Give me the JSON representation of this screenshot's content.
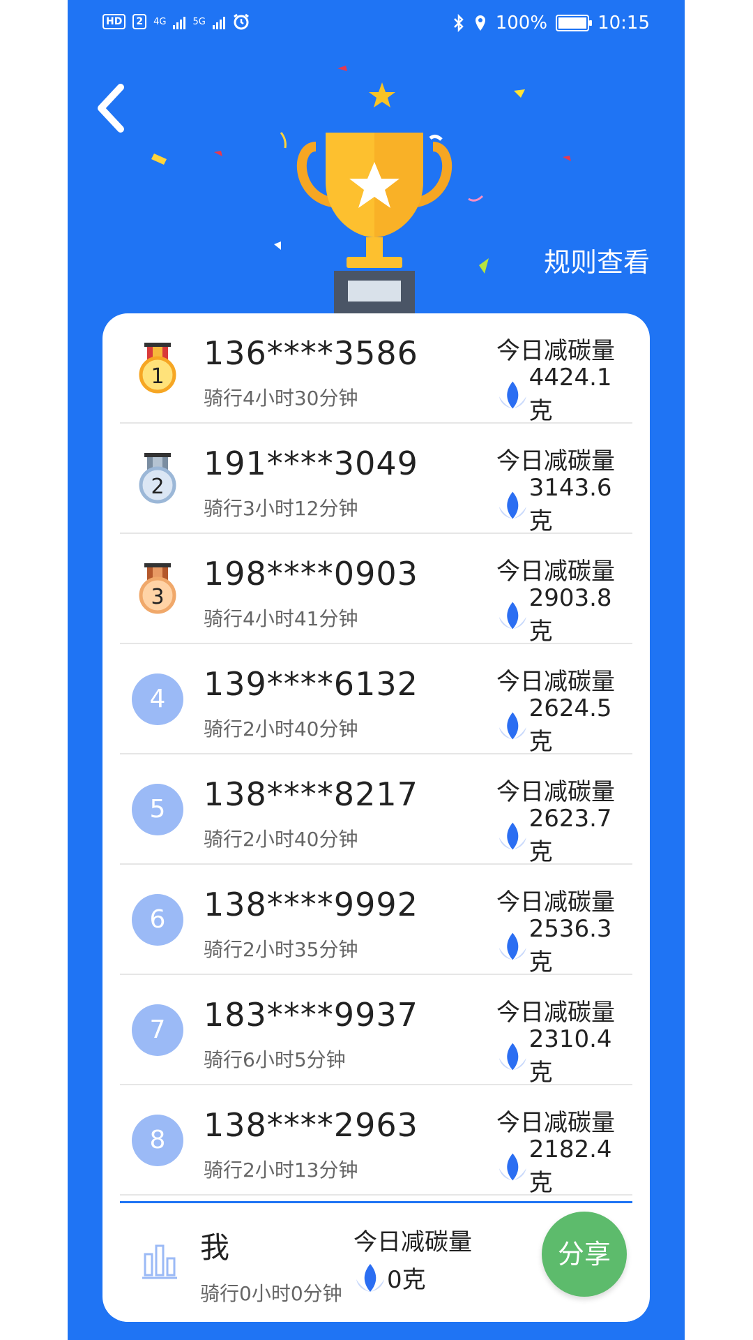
{
  "status_bar": {
    "left_badges": [
      "HD",
      "2",
      "4G",
      "5G"
    ],
    "battery": "100%",
    "time": "10:15"
  },
  "header": {
    "rules_label": "规则查看"
  },
  "colors": {
    "background": "#1f74f4",
    "card": "#ffffff",
    "rank_circle": "#9bbaf6",
    "share": "#5dbb6c",
    "leaf": "#2b6ef2"
  },
  "leaderboard": {
    "carbon_label": "今日减碳量",
    "rows": [
      {
        "rank": "1",
        "phone": "136****3586",
        "ride": "骑行4小时30分钟",
        "carbon": "4424.1克",
        "medal": "gold"
      },
      {
        "rank": "2",
        "phone": "191****3049",
        "ride": "骑行3小时12分钟",
        "carbon": "3143.6克",
        "medal": "silver"
      },
      {
        "rank": "3",
        "phone": "198****0903",
        "ride": "骑行4小时41分钟",
        "carbon": "2903.8克",
        "medal": "bronze"
      },
      {
        "rank": "4",
        "phone": "139****6132",
        "ride": "骑行2小时40分钟",
        "carbon": "2624.5克",
        "medal": ""
      },
      {
        "rank": "5",
        "phone": "138****8217",
        "ride": "骑行2小时40分钟",
        "carbon": "2623.7克",
        "medal": ""
      },
      {
        "rank": "6",
        "phone": "138****9992",
        "ride": "骑行2小时35分钟",
        "carbon": "2536.3克",
        "medal": ""
      },
      {
        "rank": "7",
        "phone": "183****9937",
        "ride": "骑行6小时5分钟",
        "carbon": "2310.4克",
        "medal": ""
      },
      {
        "rank": "8",
        "phone": "138****2963",
        "ride": "骑行2小时13分钟",
        "carbon": "2182.4克",
        "medal": ""
      }
    ]
  },
  "mine": {
    "name": "我",
    "ride": "骑行0小时0分钟",
    "carbon_label": "今日减碳量",
    "carbon": "0克",
    "share_label": "分享"
  }
}
